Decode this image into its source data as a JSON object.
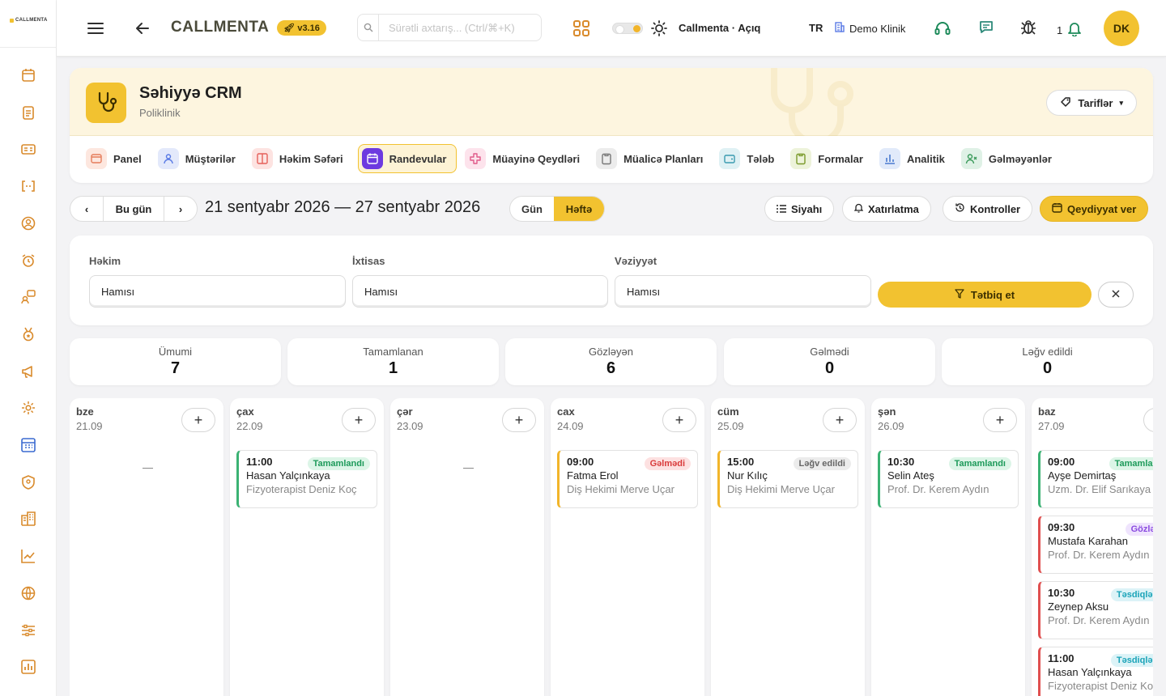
{
  "brand": {
    "rail_logo": "CALLMENTA",
    "app_name": "CALLMENTA",
    "version": "v3.16"
  },
  "topbar": {
    "search_placeholder": "Sürətli axtarış... (Ctrl/⌘+K)",
    "theme_label": "Callmenta · Açıq",
    "language": "TR",
    "clinic": "Demo Klinik",
    "notifications_count": "1",
    "avatar_initials": "DK"
  },
  "rail_icons": [
    "calendar-icon",
    "clipboard-icon",
    "id-card-icon",
    "code-brackets-icon",
    "user-circle-icon",
    "alarm-icon",
    "chat-user-icon",
    "medal-icon",
    "megaphone-icon",
    "gear-icon",
    "grid-calendar-icon",
    "shield-icon",
    "building-icon",
    "line-chart-icon",
    "globe-icon",
    "sliders-icon",
    "bar-chart-icon",
    "warning-icon"
  ],
  "module": {
    "title": "Səhiyyə CRM",
    "subtitle": "Poliklinik",
    "tariffs_label": "Tariflər",
    "tabs": [
      {
        "label": "Panel",
        "icon": "panel-icon",
        "color": "#e57c5a",
        "bg": "#fde7df"
      },
      {
        "label": "Müştərilər",
        "icon": "user-icon",
        "color": "#5a7be5",
        "bg": "#e3e9fb"
      },
      {
        "label": "Həkim Səfəri",
        "icon": "columns-icon",
        "color": "#e5605a",
        "bg": "#fde3e1"
      },
      {
        "label": "Randevular",
        "icon": "calendar-icon",
        "color": "#ffffff",
        "bg": "#6d3ae0",
        "active": true
      },
      {
        "label": "Müayinə Qeydləri",
        "icon": "plus-cross-icon",
        "color": "#e05a8a",
        "bg": "#fde3ec"
      },
      {
        "label": "Müalicə Planları",
        "icon": "clipboard-icon",
        "color": "#777777",
        "bg": "#ececec"
      },
      {
        "label": "Tələb",
        "icon": "wallet-icon",
        "color": "#3a9bb0",
        "bg": "#dff1f4"
      },
      {
        "label": "Formalar",
        "icon": "form-icon",
        "color": "#7a9a2a",
        "bg": "#edf3da"
      },
      {
        "label": "Analitik",
        "icon": "bar-chart-icon",
        "color": "#4a7bd0",
        "bg": "#e1eafa"
      },
      {
        "label": "Gəlməyənlər",
        "icon": "user-x-icon",
        "color": "#3a9a5a",
        "bg": "#dff1e6"
      }
    ]
  },
  "toolbar": {
    "today": "Bu gün",
    "date_range": "21 sentyabr 2026 — 27 sentyabr 2026",
    "view_day": "Gün",
    "view_week": "Həftə",
    "list": "Siyahı",
    "reminder": "Xatırlatma",
    "controls": "Kontroller",
    "register": "Qeydiyyat ver"
  },
  "filters": {
    "doctor": {
      "label": "Həkim",
      "value": "Hamısı"
    },
    "specialty": {
      "label": "İxtisas",
      "value": "Hamısı"
    },
    "status": {
      "label": "Vəziyyət",
      "value": "Hamısı"
    },
    "apply": "Tətbiq et"
  },
  "stats": [
    {
      "label": "Ümumi",
      "value": "7"
    },
    {
      "label": "Tamamlanan",
      "value": "1"
    },
    {
      "label": "Gözləyən",
      "value": "6"
    },
    {
      "label": "Gəlmədi",
      "value": "0"
    },
    {
      "label": "Ləğv edildi",
      "value": "0"
    }
  ],
  "status_colors": {
    "completed": {
      "text": "#1d9a5a",
      "bg": "#dcf5e7",
      "bar": "#3bb273"
    },
    "noshow": {
      "text": "#d93a3a",
      "bg": "#fde1e1",
      "bar": "#f2b52a"
    },
    "cancelled": {
      "text": "#666666",
      "bg": "#ececec",
      "bar": "#f2b52a"
    },
    "confirmed": {
      "text": "#1aa3b8",
      "bg": "#dcf3f7",
      "bar": "#e05050"
    },
    "waiting": {
      "text": "#8a4ae0",
      "bg": "#efe4fd",
      "bar": "#e05050"
    }
  },
  "week": [
    {
      "name": "bze",
      "date": "21.09",
      "empty": "—",
      "appointments": []
    },
    {
      "name": "çax",
      "date": "22.09",
      "appointments": [
        {
          "time": "11:00",
          "patient": "Hasan Yalçınkaya",
          "doctor": "Fizyoterapist Deniz Koç",
          "status": "Tamamlandı",
          "kind": "completed"
        }
      ]
    },
    {
      "name": "çər",
      "date": "23.09",
      "empty": "—",
      "appointments": []
    },
    {
      "name": "cax",
      "date": "24.09",
      "appointments": [
        {
          "time": "09:00",
          "patient": "Fatma Erol",
          "doctor": "Diş Hekimi Merve Uçar",
          "status": "Gəlmədi",
          "kind": "noshow"
        }
      ]
    },
    {
      "name": "cüm",
      "date": "25.09",
      "appointments": [
        {
          "time": "15:00",
          "patient": "Nur Kılıç",
          "doctor": "Diş Hekimi Merve Uçar",
          "status": "Ləğv edildi",
          "kind": "cancelled"
        }
      ]
    },
    {
      "name": "şən",
      "date": "26.09",
      "appointments": [
        {
          "time": "10:30",
          "patient": "Selin Ateş",
          "doctor": "Prof. Dr. Kerem Aydın",
          "status": "Tamamlandı",
          "kind": "completed"
        }
      ]
    },
    {
      "name": "baz",
      "date": "27.09",
      "appointments": [
        {
          "time": "09:00",
          "patient": "Ayşe Demirtaş",
          "doctor": "Uzm. Dr. Elif Sarıkaya",
          "status": "Tamamlandı",
          "kind": "completed"
        },
        {
          "time": "09:30",
          "patient": "Mustafa Karahan",
          "doctor": "Prof. Dr. Kerem Aydın",
          "status": "Gözləyir",
          "kind": "waiting"
        },
        {
          "time": "10:30",
          "patient": "Zeynep Aksu",
          "doctor": "Prof. Dr. Kerem Aydın",
          "status": "Təsdiqləndi",
          "kind": "confirmed"
        },
        {
          "time": "11:00",
          "patient": "Hasan Yalçınkaya",
          "doctor": "Fizyoterapist Deniz Koç",
          "status": "Təsdiqləndi",
          "kind": "confirmed"
        }
      ]
    }
  ]
}
